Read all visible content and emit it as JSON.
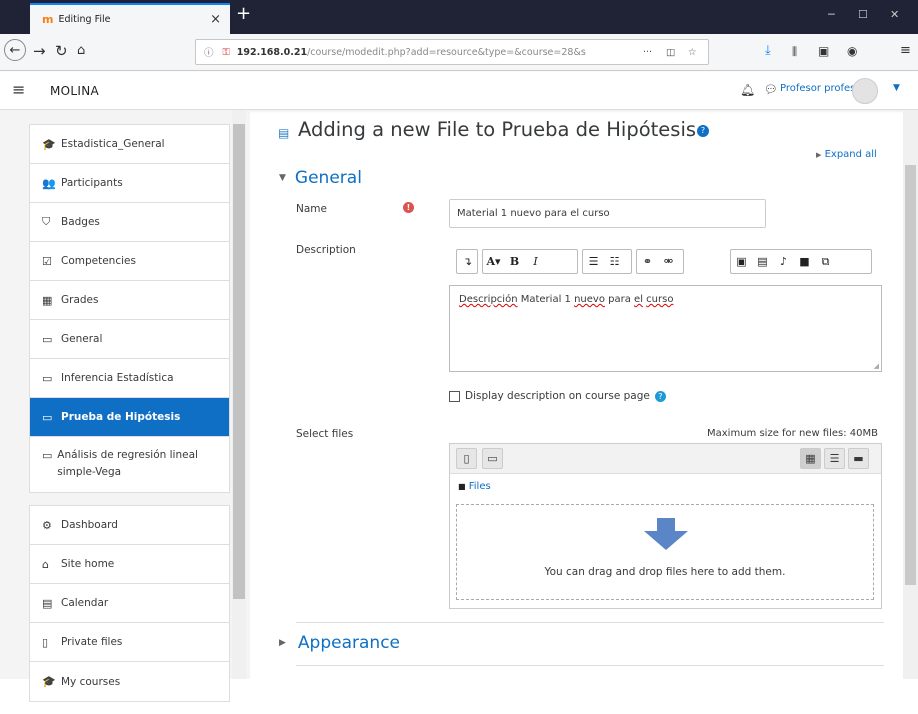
{
  "browser": {
    "tab_title": "Editing File",
    "tab_icon_glyph": "m",
    "url_host": "192.168.0.21",
    "url_path": "/course/modedit.php?add=resource&type=&course=28&s",
    "menu_dots": "···"
  },
  "header": {
    "site_name": "MOLINA",
    "user_name": "Profesor profesor"
  },
  "sidebar": {
    "groups": [
      [
        {
          "label": "Estadistica_General",
          "icon": "graduation-cap-icon",
          "glyph": "🎓"
        },
        {
          "label": "Participants",
          "icon": "users-icon",
          "glyph": "👥"
        },
        {
          "label": "Badges",
          "icon": "shield-icon",
          "glyph": "⛉"
        },
        {
          "label": "Competencies",
          "icon": "checkbox-icon",
          "glyph": "☑"
        },
        {
          "label": "Grades",
          "icon": "table-icon",
          "glyph": "▦"
        },
        {
          "label": "General",
          "icon": "folder-icon",
          "glyph": "▭"
        },
        {
          "label": "Inferencia Estadística",
          "icon": "folder-icon",
          "glyph": "▭"
        },
        {
          "label": "Prueba de Hipótesis",
          "icon": "folder-icon",
          "glyph": "▭",
          "active": true
        },
        {
          "label": "Análisis de regresión lineal simple-Vega",
          "icon": "folder-icon",
          "glyph": "▭"
        }
      ],
      [
        {
          "label": "Dashboard",
          "icon": "dashboard-icon",
          "glyph": "⚙"
        },
        {
          "label": "Site home",
          "icon": "home-icon",
          "glyph": "⌂"
        },
        {
          "label": "Calendar",
          "icon": "calendar-icon",
          "glyph": "▤"
        },
        {
          "label": "Private files",
          "icon": "file-icon",
          "glyph": "▯"
        },
        {
          "label": "My courses",
          "icon": "graduation-cap-icon",
          "glyph": "🎓"
        }
      ]
    ]
  },
  "page": {
    "title": "Adding a new File to Prueba de Hipótesis",
    "expand_all": "Expand all",
    "general_section": "General",
    "name_label": "Name",
    "name_value": "Material 1 nuevo para el curso",
    "description_label": "Description",
    "description_words": [
      "Descripción",
      "Material 1",
      "nuevo",
      "para",
      "el",
      "curso"
    ],
    "display_description": "Display description on course page",
    "select_files_label": "Select files",
    "max_size": "Maximum size for new files: 40MB",
    "files_crumb": "Files",
    "drop_text": "You can drag and drop files here to add them.",
    "appearance_section": "Appearance"
  },
  "colors": {
    "accent": "#0f6fc5",
    "required": "#d9534f",
    "firefox_tab_accent": "#0a84ff"
  }
}
